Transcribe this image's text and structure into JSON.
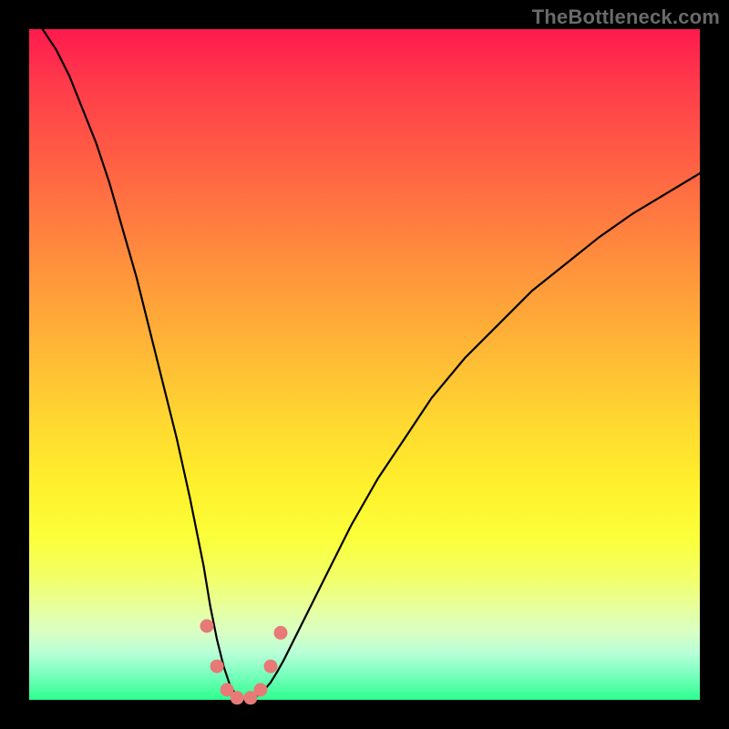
{
  "watermark": "TheBottleneck.com",
  "chart_data": {
    "type": "line",
    "title": "",
    "xlabel": "",
    "ylabel": "",
    "xlim": [
      0,
      100
    ],
    "ylim": [
      0,
      100
    ],
    "grid": false,
    "legend": false,
    "series": [
      {
        "name": "bottleneck-curve",
        "x": [
          2,
          4,
          6,
          8,
          10,
          12,
          14,
          16,
          18,
          20,
          22,
          24,
          26,
          27,
          28,
          29,
          30,
          31,
          32,
          33,
          34,
          35,
          36,
          37,
          38,
          40,
          42,
          44,
          48,
          52,
          56,
          60,
          65,
          70,
          75,
          80,
          85,
          90,
          95,
          100
        ],
        "values": [
          100,
          97,
          93,
          88,
          83,
          77,
          70,
          63,
          55,
          47,
          39,
          30,
          20,
          14,
          9,
          5,
          2,
          0.6,
          0.2,
          0.2,
          0.6,
          1.4,
          2.6,
          4.2,
          6,
          10,
          14,
          18,
          26,
          33,
          39,
          45,
          51,
          56,
          61,
          65,
          69,
          72.5,
          75.5,
          78.5
        ]
      }
    ],
    "markers": {
      "name": "highlighted-points",
      "color": "#e77a77",
      "x": [
        26.5,
        28.0,
        29.5,
        31.0,
        33.0,
        34.5,
        36.0,
        37.5
      ],
      "values": [
        11.0,
        5.0,
        1.5,
        0.3,
        0.3,
        1.5,
        5.0,
        10.0
      ]
    }
  }
}
